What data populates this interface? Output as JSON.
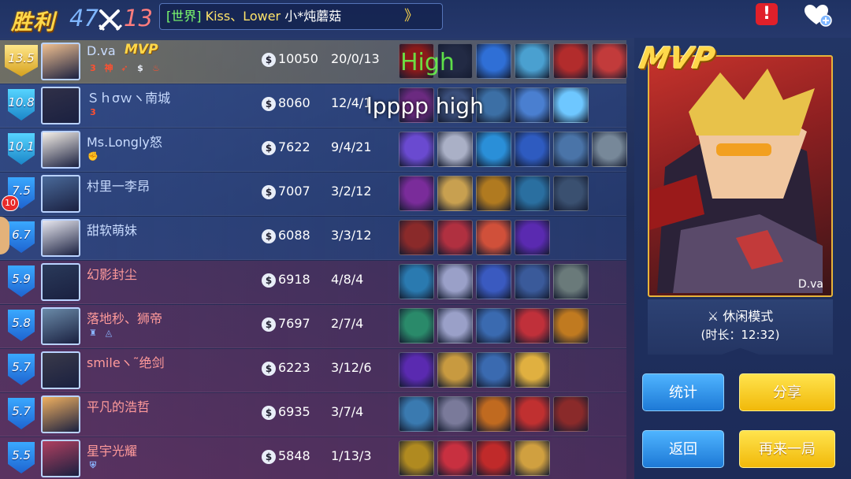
{
  "header": {
    "result": "胜利",
    "blue_kills": "47",
    "red_kills": "13",
    "chat_channel": "[世界]",
    "chat_name": " Kiss、Lower ",
    "chat_text": "小*炖蘑菇",
    "chat_arrow": "》",
    "report_label": "!"
  },
  "players": [
    {
      "rating": "13.5",
      "name": "D.va",
      "gold": "10050",
      "kda": "20/0/13",
      "mvp": true,
      "team": "blue",
      "badges": [
        "3",
        "神",
        "➶",
        "$",
        "♨"
      ],
      "items": [
        "#8b1a1a",
        "#222a44",
        "#2f6fd6",
        "#4aa0d0",
        "#b22c2c",
        "#c23b3b"
      ]
    },
    {
      "rating": "10.8",
      "name": "Ｓｈσｗヽ南城",
      "gold": "8060",
      "kda": "12/4/1",
      "team": "blue",
      "badges": [
        "3"
      ],
      "items": [
        "#6b2a80",
        "#3a4e7a",
        "#3c6fa5",
        "#4a7fd0",
        "#6ec7ff"
      ]
    },
    {
      "rating": "10.1",
      "name": "Ms.Longly怒",
      "gold": "7622",
      "kda": "9/4/21",
      "team": "blue",
      "badges": [
        "✊"
      ],
      "items": [
        "#6a4ad0",
        "#aab0c6",
        "#2a8fd8",
        "#2e5bc0",
        "#4a74a8",
        "#778899"
      ]
    },
    {
      "rating": "7.5",
      "name": "村里一李昂",
      "gold": "7007",
      "kda": "3/2/12",
      "team": "blue",
      "badges": [],
      "items": [
        "#7a2c9a",
        "#c8a050",
        "#b07a20",
        "#2a6fa0",
        "#3a5070"
      ]
    },
    {
      "rating": "6.7",
      "name": "甜软萌妹",
      "gold": "6088",
      "kda": "3/3/12",
      "team": "blue",
      "badges": [],
      "items": [
        "#8a2a2a",
        "#b03040",
        "#d0503a",
        "#5a2ab0"
      ]
    },
    {
      "rating": "5.9",
      "name": "幻影封尘",
      "gold": "6918",
      "kda": "4/8/4",
      "team": "red",
      "badges": [],
      "items": [
        "#2a7ab0",
        "#9aa0c8",
        "#3a5ac0",
        "#3a5a9a",
        "#6a7a7a"
      ]
    },
    {
      "rating": "5.8",
      "name": "落地秒、狮帝",
      "gold": "7697",
      "kda": "2/7/4",
      "team": "red",
      "badges": [
        "♜",
        "◬"
      ],
      "items": [
        "#2a8a6a",
        "#9aa0c8",
        "#3a6ab0",
        "#c0303a",
        "#c07a20"
      ]
    },
    {
      "rating": "5.7",
      "name": "smileヽ˜绝剑",
      "gold": "6223",
      "kda": "3/12/6",
      "team": "red",
      "badges": [],
      "items": [
        "#5a2ab0",
        "#c89a40",
        "#3a6ab0",
        "#e0b040"
      ]
    },
    {
      "rating": "5.7",
      "name": "平凡的浩哲",
      "gold": "6935",
      "kda": "3/7/4",
      "team": "red",
      "badges": [],
      "items": [
        "#3a7ab0",
        "#7a7a9a",
        "#c06a20",
        "#c03030",
        "#8a2a2a"
      ]
    },
    {
      "rating": "5.5",
      "name": "星宇光耀",
      "gold": "5848",
      "kda": "1/13/3",
      "team": "red",
      "badges": [
        "⛨"
      ],
      "items": [
        "#b08a20",
        "#c83040",
        "#c02a2a",
        "#d0a040"
      ]
    }
  ],
  "mvp_panel": {
    "title": "MVP",
    "row_tag": "MVP",
    "hero_name": "D.va",
    "mode": "休闲模式",
    "duration": "(时长：12:32)"
  },
  "buttons": {
    "stats": "统计",
    "share": "分享",
    "back": "返回",
    "again": "再来一局"
  },
  "overlays": {
    "high": "High",
    "lppp": "lpppp high",
    "notification_count": "10"
  }
}
